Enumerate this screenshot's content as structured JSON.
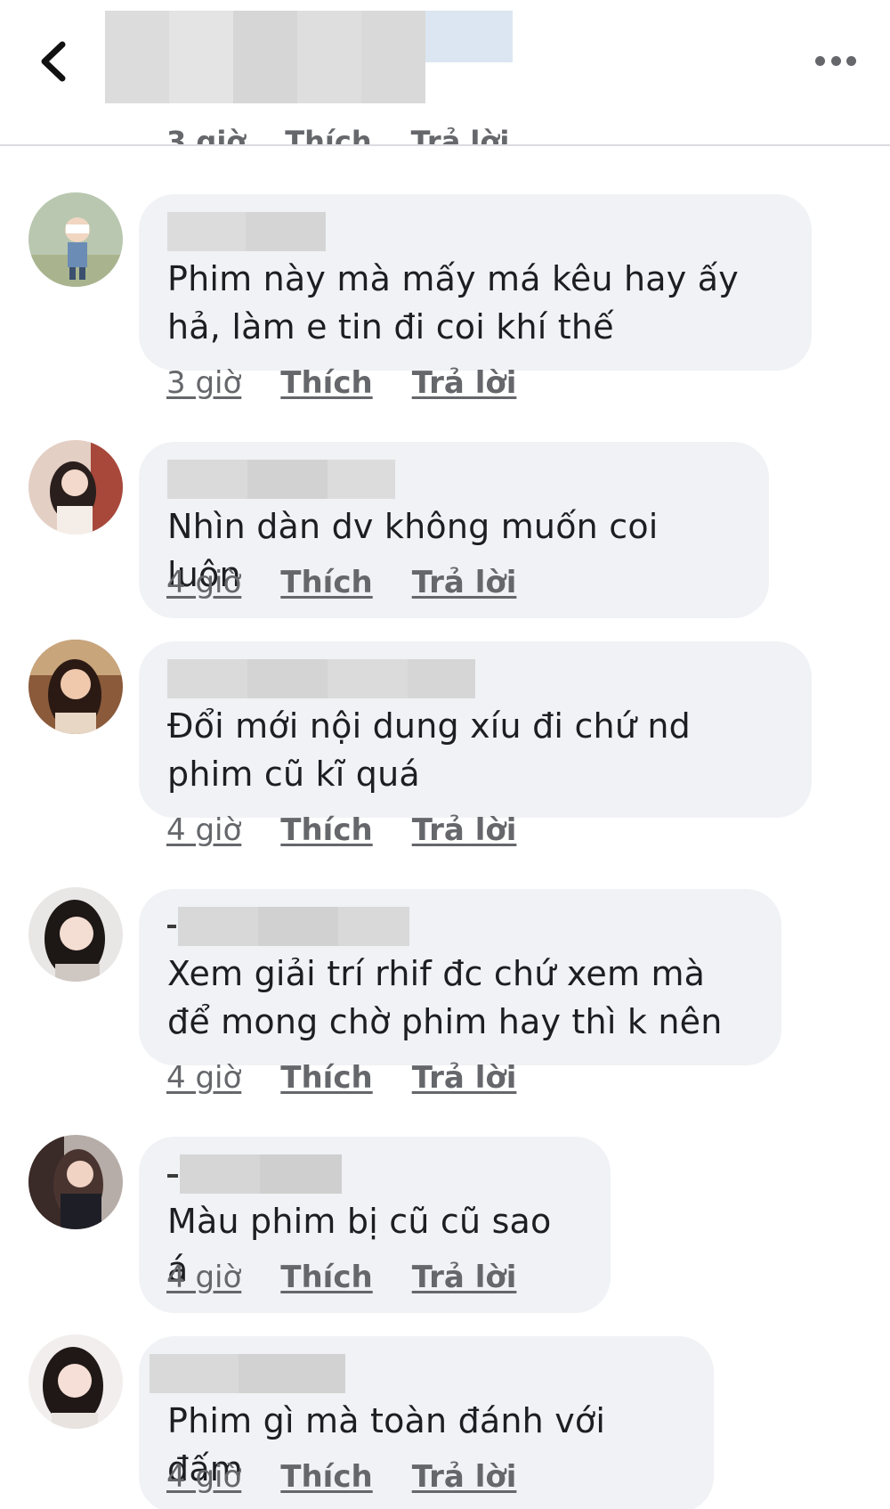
{
  "header": {
    "back_icon": "chevron-left-icon",
    "more_icon": "more-horizontal-icon",
    "peek_actions": [
      "3 giờ",
      "Thích",
      "Trả lời"
    ]
  },
  "colors": {
    "bubble": "#f0f2f5",
    "text": "#1c1e21",
    "meta": "#65676b",
    "blur": "#d9d9d9"
  },
  "comments": [
    {
      "text": "Phim này mà mấy má kêu hay ấy hả, làm e tin đi coi khí thế",
      "time": "3 giờ",
      "like": "Thích",
      "reply": "Trả lời"
    },
    {
      "text": "Nhìn dàn dv không muốn coi luôn",
      "time": "4 giờ",
      "like": "Thích",
      "reply": "Trả lời"
    },
    {
      "text": "Đổi mới nội dung xíu đi chứ nd phim cũ kĩ quá",
      "time": "4 giờ",
      "like": "Thích",
      "reply": "Trả lời"
    },
    {
      "text": "Xem giải trí rhif đc chứ xem mà để mong chờ phim hay thì k nên",
      "time": "4 giờ",
      "like": "Thích",
      "reply": "Trả lời"
    },
    {
      "text": "Màu phim bị cũ cũ sao á",
      "time": "4 giờ",
      "like": "Thích",
      "reply": "Trả lời"
    },
    {
      "text": "Phim gì mà toàn đánh với đấm",
      "time": "4 giờ",
      "like": "Thích",
      "reply": "Trả lời"
    }
  ]
}
